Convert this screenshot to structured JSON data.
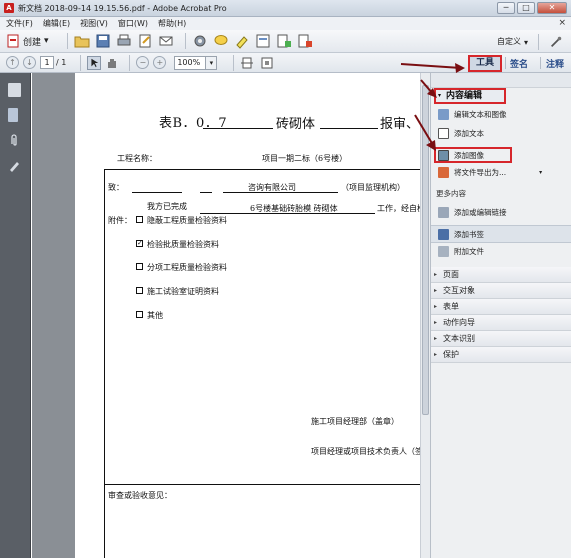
{
  "window": {
    "title": "新文档 2018-09-14 19.15.56.pdf - Adobe Acrobat Pro",
    "min": "─",
    "max": "□",
    "close": "✕"
  },
  "menu": {
    "items": [
      "文件(F)",
      "编辑(E)",
      "视图(V)",
      "窗口(W)",
      "帮助(H)"
    ],
    "close": "×"
  },
  "toolbar": {
    "create_label": "创建",
    "customize_label": "自定义"
  },
  "nav": {
    "page_current": "1",
    "page_total": "/ 1",
    "zoom": "100%"
  },
  "tabs": {
    "tools": "工具",
    "sign": "签名",
    "comment": "注释"
  },
  "document": {
    "title_left": "表B．0．7",
    "title_mid": "砖砌体",
    "title_end": "报审、",
    "project_label": "工程名称：",
    "project_value": "项目一期二标（6号楼）",
    "to_label": "致：",
    "company": "咨询有限公司",
    "supervisor": "（项目监理机构）",
    "completed": "我方已完成",
    "work_item": "6号楼基础砖胎模 砖砌体",
    "work_suffix": "工作，经自检",
    "attach_label": "附件：",
    "attach_items": [
      "隐蔽工程质量检验资料",
      "检验批质量检验资料",
      "分项工程质量检验资料",
      "施工试验室证明资料",
      "其他"
    ],
    "check_mark": "✓",
    "dept_sign": "施工项目经理部（盖章）",
    "manager_sign": "项目经理或项目技术负责人（签",
    "review": "审查或验收意见："
  },
  "panel": {
    "content_edit": "内容编辑",
    "items": [
      "编辑文本和图像",
      "添加文本",
      "添加图像",
      "将文件导出为..."
    ],
    "more_content": "更多内容",
    "more_items": [
      "添加或编辑链接",
      "添加书签",
      "附加文件"
    ],
    "sections": [
      "页面",
      "交互对象",
      "表单",
      "动作向导",
      "文本识别",
      "保护"
    ]
  },
  "colors": {
    "highlight_red": "#d6262b",
    "nav_dark": "#5a5f66",
    "doc_gray": "#8a8f95"
  }
}
